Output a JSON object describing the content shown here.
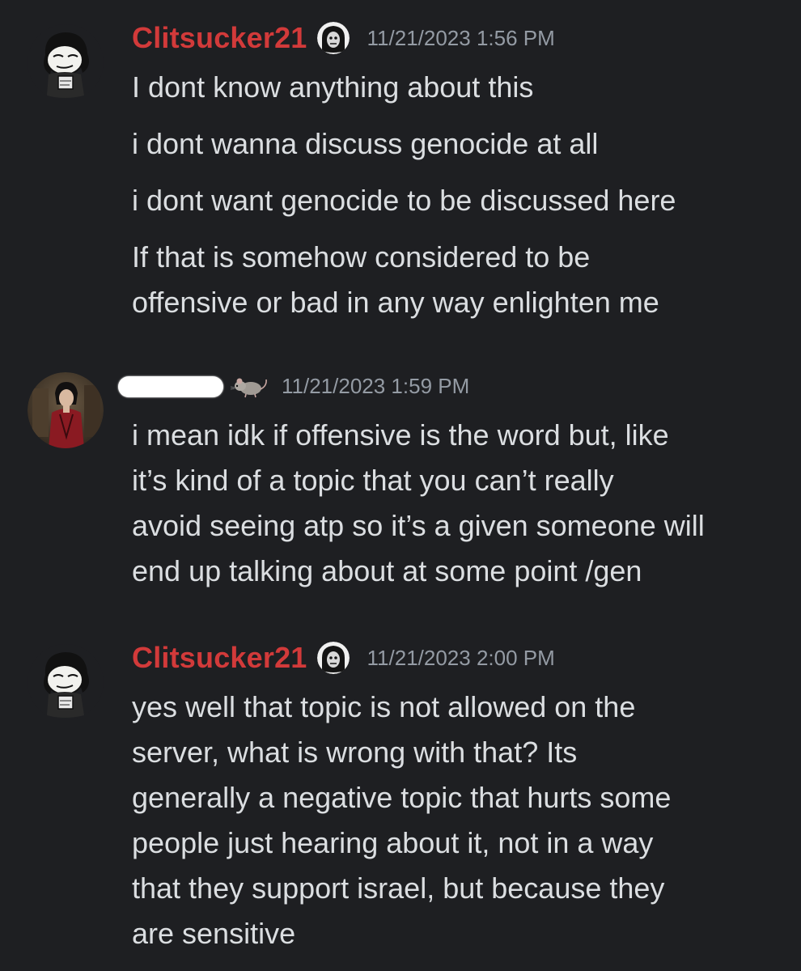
{
  "colors": {
    "background": "#1e1f22",
    "username": "#d23a3a",
    "timestamp": "#949ba4",
    "text": "#dbdee1"
  },
  "messages": [
    {
      "author": "Clitsucker21",
      "badge": "skull-mask-icon",
      "timestamp": "11/21/2023 1:56 PM",
      "lines": [
        "I dont know anything about this",
        "i dont wanna discuss genocide at all",
        "i dont want genocide to be discussed here",
        "If that is somehow considered to be",
        "offensive or bad in any way enlighten me"
      ]
    },
    {
      "author": "",
      "badge": "rat-icon",
      "timestamp": "11/21/2023 1:59 PM",
      "lines": [
        "i mean idk if offensive is the word but, like",
        "it’s kind of a topic that you can’t really",
        "avoid seeing atp so it’s a given someone will",
        "end up talking about at some point /gen"
      ]
    },
    {
      "author": "Clitsucker21",
      "badge": "skull-mask-icon",
      "timestamp": "11/21/2023 2:00 PM",
      "lines": [
        "yes well that topic is not allowed on the",
        "server, what is wrong with that? Its",
        "generally a negative topic that hurts some",
        "people just hearing about it, not in a way",
        "that they support israel, but because they",
        "are sensitive"
      ]
    }
  ]
}
